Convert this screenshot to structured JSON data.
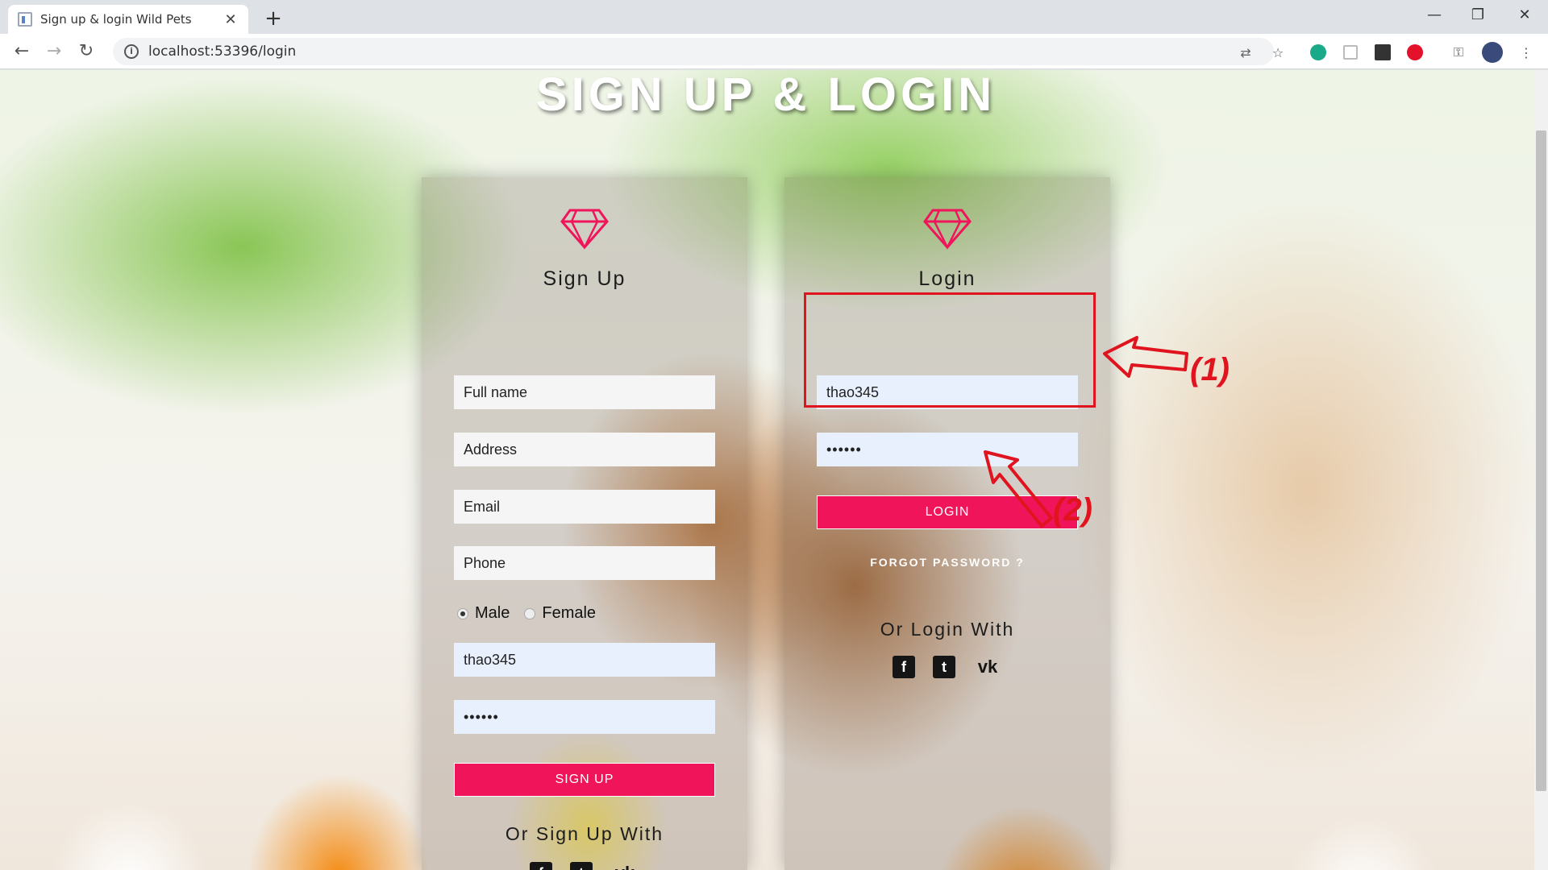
{
  "browser": {
    "tab_title": "Sign up & login Wild Pets",
    "tab_close": "✕",
    "new_tab": "+",
    "url": "localhost:53396/login",
    "win_min": "—",
    "win_max": "❐",
    "win_close": "✕"
  },
  "page": {
    "heading": "SIGN UP & LOGIN"
  },
  "signup": {
    "title": "Sign Up",
    "full_name_placeholder": "Full name",
    "address_placeholder": "Address",
    "email_placeholder": "Email",
    "phone_placeholder": "Phone",
    "gender_male": "Male",
    "gender_female": "Female",
    "gender_selected": "Male",
    "username_value": "thao345",
    "password_value": "••••••",
    "button": "SIGN UP",
    "social_heading": "Or Sign Up With",
    "social_icons": [
      "facebook-icon",
      "twitter-icon",
      "vk-icon"
    ]
  },
  "login": {
    "title": "Login",
    "username_value": "thao345",
    "password_value": "••••••",
    "button": "LOGIN",
    "forgot": "FORGOT PASSWORD ?",
    "social_heading": "Or Login With",
    "social_icons": [
      "facebook-icon",
      "twitter-icon",
      "vk-icon"
    ]
  },
  "annotations": {
    "label1": "(1)",
    "label2": "(2)",
    "color": "#e0141e"
  },
  "colors": {
    "accent": "#f0145a"
  }
}
